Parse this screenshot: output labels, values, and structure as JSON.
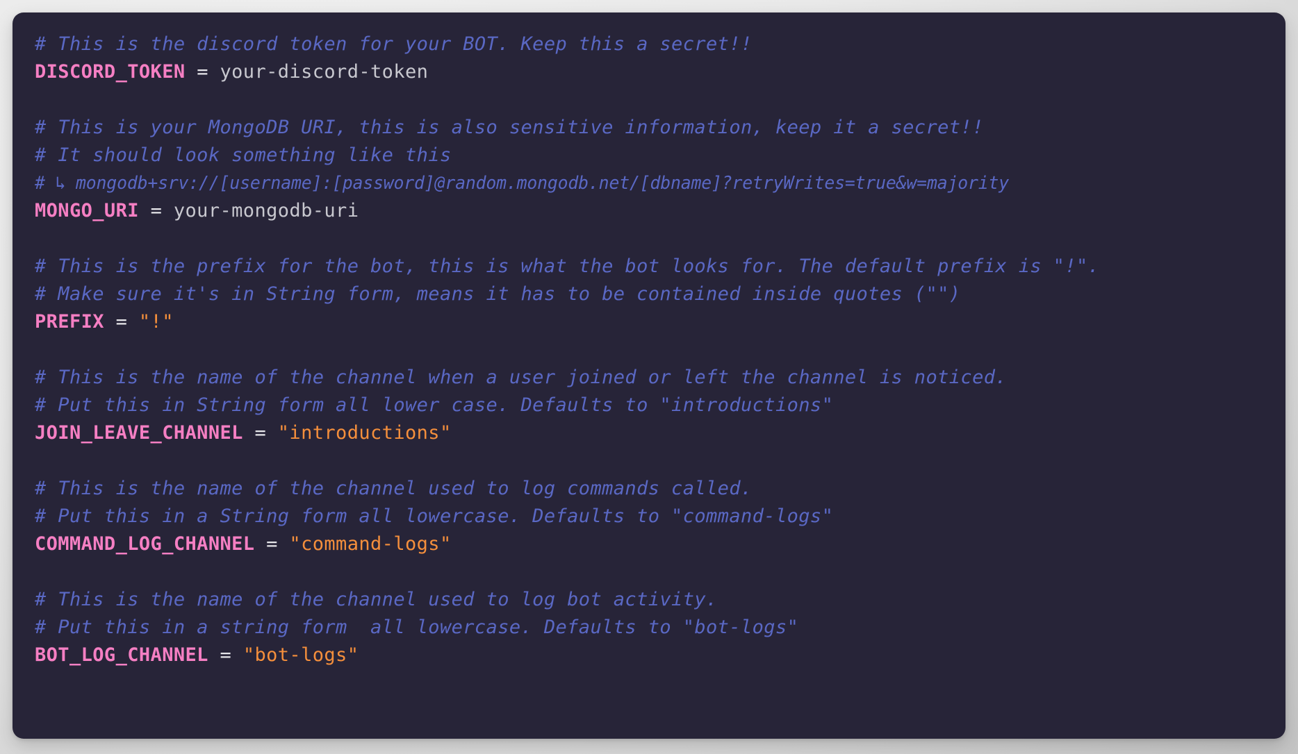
{
  "window": {
    "kind": "code-block",
    "language": "dotenv",
    "filename": ".env"
  },
  "theme": {
    "page_background": "#e6e6e6",
    "card_background": "#272438",
    "comment_color": "#5a68c4",
    "key_color": "#f57fc3",
    "operator_color": "#e6e6ea",
    "plain_value_color": "#c8c8cf",
    "string_color": "#f58f3c",
    "card_radius_px": 16
  },
  "code": {
    "lines": [
      {
        "index": 1,
        "type": "comment",
        "text": "# This is the discord token for your BOT. Keep this a secret!!"
      },
      {
        "index": 2,
        "type": "assignment",
        "key": "DISCORD_TOKEN",
        "operator": "=",
        "value": "your-discord-token",
        "value_kind": "plain"
      },
      {
        "index": 3,
        "type": "blank",
        "text": ""
      },
      {
        "index": 4,
        "type": "comment",
        "text": "# This is your MongoDB URI, this is also sensitive information, keep it a secret!!"
      },
      {
        "index": 5,
        "type": "comment",
        "text": "# It should look something like this"
      },
      {
        "index": 6,
        "type": "comment",
        "long": true,
        "text": "# ↳ mongodb+srv://[username]:[password]@random.mongodb.net/[dbname]?retryWrites=true&w=majority"
      },
      {
        "index": 7,
        "type": "assignment",
        "key": "MONGO_URI",
        "operator": "=",
        "value": "your-mongodb-uri",
        "value_kind": "plain"
      },
      {
        "index": 8,
        "type": "blank",
        "text": ""
      },
      {
        "index": 9,
        "type": "comment",
        "text": "# This is the prefix for the bot, this is what the bot looks for. The default prefix is \"!\"."
      },
      {
        "index": 10,
        "type": "comment",
        "text": "# Make sure it's in String form, means it has to be contained inside quotes (\"\")"
      },
      {
        "index": 11,
        "type": "assignment",
        "key": "PREFIX",
        "operator": "=",
        "value": "\"!\"",
        "value_kind": "string"
      },
      {
        "index": 12,
        "type": "blank",
        "text": ""
      },
      {
        "index": 13,
        "type": "comment",
        "text": "# This is the name of the channel when a user joined or left the channel is noticed."
      },
      {
        "index": 14,
        "type": "comment",
        "text": "# Put this in String form all lower case. Defaults to \"introductions\""
      },
      {
        "index": 15,
        "type": "assignment",
        "key": "JOIN_LEAVE_CHANNEL",
        "operator": "=",
        "value": "\"introductions\"",
        "value_kind": "string"
      },
      {
        "index": 16,
        "type": "blank",
        "text": ""
      },
      {
        "index": 17,
        "type": "comment",
        "text": "# This is the name of the channel used to log commands called."
      },
      {
        "index": 18,
        "type": "comment",
        "text": "# Put this in a String form all lowercase. Defaults to \"command-logs\""
      },
      {
        "index": 19,
        "type": "assignment",
        "key": "COMMAND_LOG_CHANNEL",
        "operator": "=",
        "value": "\"command-logs\"",
        "value_kind": "string"
      },
      {
        "index": 20,
        "type": "blank",
        "text": ""
      },
      {
        "index": 21,
        "type": "comment",
        "text": "# This is the name of the channel used to log bot activity."
      },
      {
        "index": 22,
        "type": "comment",
        "text": "# Put this in a string form  all lowercase. Defaults to \"bot-logs\""
      },
      {
        "index": 23,
        "type": "assignment",
        "key": "BOT_LOG_CHANNEL",
        "operator": "=",
        "value": "\"bot-logs\"",
        "value_kind": "string"
      }
    ]
  }
}
